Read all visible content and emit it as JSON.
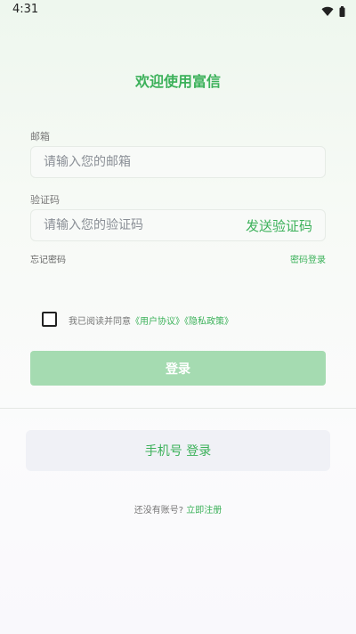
{
  "status_bar": {
    "time": "4:31"
  },
  "title": "欢迎使用富信",
  "email": {
    "label": "邮箱",
    "placeholder": "请输入您的邮箱"
  },
  "code": {
    "label": "验证码",
    "placeholder": "请输入您的验证码",
    "send_label": "发送验证码"
  },
  "links": {
    "forgot_password": "忘记密码",
    "password_login": "密码登录"
  },
  "agreement": {
    "prefix": "我已阅读并同意",
    "user_agreement": "《用户协议》",
    "privacy_policy": "《隐私政策》",
    "checked": false
  },
  "login_button": "登录",
  "phone_login_button": "手机号 登录",
  "register": {
    "prompt": "还没有账号?",
    "link": "立即注册"
  },
  "colors": {
    "accent": "#3cb15a",
    "button_disabled": "#a5dbb1"
  },
  "icons": [
    "wifi-icon",
    "battery-icon"
  ]
}
